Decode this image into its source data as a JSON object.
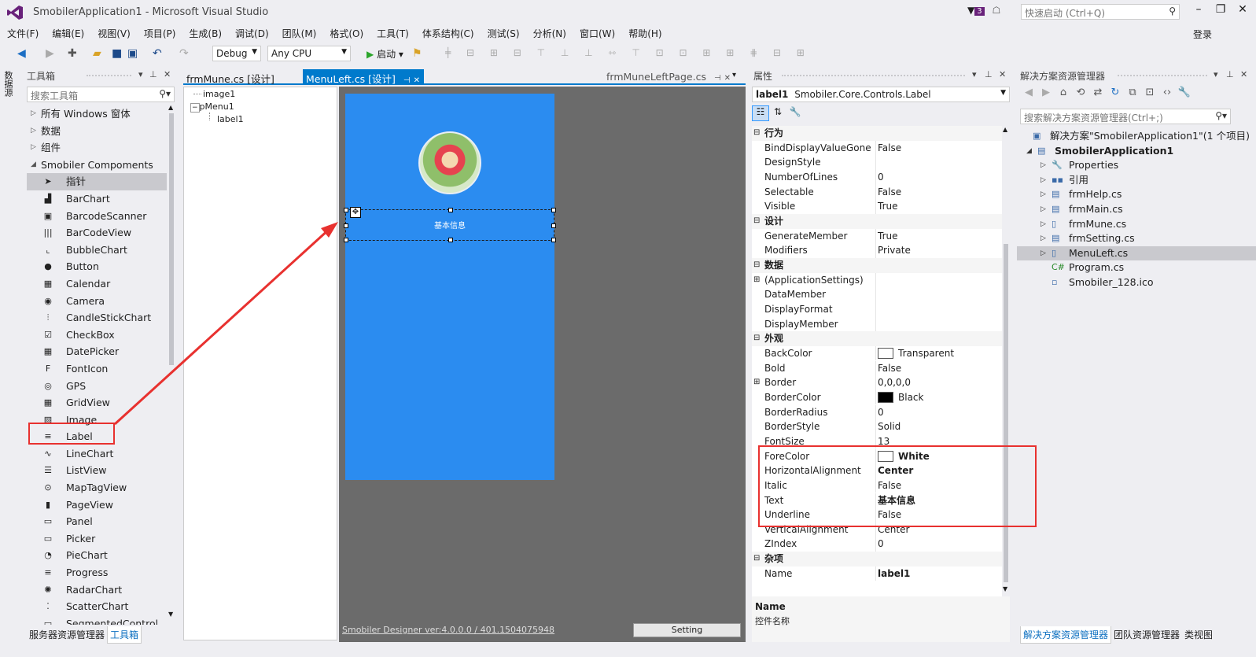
{
  "window": {
    "title": "SmobilerApplication1 - Microsoft Visual Studio",
    "notif_count": "3",
    "quick_launch_placeholder": "快速启动 (Ctrl+Q)",
    "login": "登录"
  },
  "menu": [
    "文件(F)",
    "编辑(E)",
    "视图(V)",
    "项目(P)",
    "生成(B)",
    "调试(D)",
    "团队(M)",
    "格式(O)",
    "工具(T)",
    "体系结构(C)",
    "测试(S)",
    "分析(N)",
    "窗口(W)",
    "帮助(H)"
  ],
  "toolbar": {
    "config": "Debug",
    "platform": "Any CPU",
    "start": "启动"
  },
  "left_strip": {
    "vertical_tab": "数据源"
  },
  "toolbox": {
    "title": "工具箱",
    "search_placeholder": "搜索工具箱",
    "categories": [
      "所有 Windows 窗体",
      "数据",
      "组件",
      "Smobiler Compoments"
    ],
    "items": [
      {
        "label": "指针",
        "icon": "pointer-icon",
        "selected": true
      },
      {
        "label": "BarChart",
        "icon": "bar-chart-icon"
      },
      {
        "label": "BarcodeScanner",
        "icon": "barcode-scanner-icon"
      },
      {
        "label": "BarCodeView",
        "icon": "barcode-icon"
      },
      {
        "label": "BubbleChart",
        "icon": "bubble-chart-icon"
      },
      {
        "label": "Button",
        "icon": "button-icon"
      },
      {
        "label": "Calendar",
        "icon": "calendar-icon"
      },
      {
        "label": "Camera",
        "icon": "camera-icon"
      },
      {
        "label": "CandleStickChart",
        "icon": "candlestick-icon"
      },
      {
        "label": "CheckBox",
        "icon": "checkbox-icon"
      },
      {
        "label": "DatePicker",
        "icon": "date-picker-icon"
      },
      {
        "label": "FontIcon",
        "icon": "font-icon-icon"
      },
      {
        "label": "GPS",
        "icon": "gps-icon"
      },
      {
        "label": "GridView",
        "icon": "grid-icon"
      },
      {
        "label": "Image",
        "icon": "image-icon"
      },
      {
        "label": "Label",
        "icon": "label-icon",
        "highlighted": true
      },
      {
        "label": "LineChart",
        "icon": "line-chart-icon"
      },
      {
        "label": "ListView",
        "icon": "list-icon"
      },
      {
        "label": "MapTagView",
        "icon": "map-pin-icon"
      },
      {
        "label": "PageView",
        "icon": "page-icon"
      },
      {
        "label": "Panel",
        "icon": "panel-icon"
      },
      {
        "label": "Picker",
        "icon": "picker-icon"
      },
      {
        "label": "PieChart",
        "icon": "pie-chart-icon"
      },
      {
        "label": "Progress",
        "icon": "progress-icon"
      },
      {
        "label": "RadarChart",
        "icon": "radar-chart-icon"
      },
      {
        "label": "ScatterChart",
        "icon": "scatter-chart-icon"
      },
      {
        "label": "SegmentedControl",
        "icon": "segmented-icon"
      }
    ],
    "bottom_tabs": [
      "服务器资源管理器",
      "工具箱"
    ]
  },
  "document": {
    "tabs": [
      {
        "label": "frmMune.cs [设计]"
      },
      {
        "label": "MenuLeft.cs [设计]",
        "active": true
      },
      {
        "label": "frmMuneLeftPage.cs"
      }
    ],
    "tree": [
      "image1",
      "pMenu1",
      "label1"
    ],
    "label_text": "基本信息",
    "version_link": "Smobiler Designer ver:4.0.0.0 / 401.1504075948",
    "setting_button": "Setting"
  },
  "properties": {
    "title": "属性",
    "object": "label1",
    "object_type": "Smobiler.Core.Controls.Label",
    "rows": [
      {
        "cat": "行为"
      },
      {
        "name": "BindDisplayValueGone",
        "value": "False"
      },
      {
        "name": "DesignStyle",
        "value": ""
      },
      {
        "name": "NumberOfLines",
        "value": "0"
      },
      {
        "name": "Selectable",
        "value": "False"
      },
      {
        "name": "Visible",
        "value": "True"
      },
      {
        "cat": "设计"
      },
      {
        "name": "GenerateMember",
        "value": "True"
      },
      {
        "name": "Modifiers",
        "value": "Private"
      },
      {
        "cat": "数据"
      },
      {
        "name": "(ApplicationSettings)",
        "value": "",
        "expand": true
      },
      {
        "name": "DataMember",
        "value": ""
      },
      {
        "name": "DisplayFormat",
        "value": ""
      },
      {
        "name": "DisplayMember",
        "value": ""
      },
      {
        "cat": "外观"
      },
      {
        "name": "BackColor",
        "value": "Transparent",
        "swatch": "#ffffff"
      },
      {
        "name": "Bold",
        "value": "False"
      },
      {
        "name": "Border",
        "value": "0,0,0,0",
        "expand": true
      },
      {
        "name": "BorderColor",
        "value": "Black",
        "swatch": "#000000"
      },
      {
        "name": "BorderRadius",
        "value": "0"
      },
      {
        "name": "BorderStyle",
        "value": "Solid"
      },
      {
        "name": "FontSize",
        "value": "13"
      },
      {
        "name": "ForeColor",
        "value": "White",
        "swatch": "#ffffff",
        "bold": true
      },
      {
        "name": "HorizontalAlignment",
        "value": "Center",
        "bold": true
      },
      {
        "name": "Italic",
        "value": "False"
      },
      {
        "name": "Text",
        "value": "基本信息",
        "bold": true
      },
      {
        "name": "Underline",
        "value": "False"
      },
      {
        "name": "VerticalAlignment",
        "value": "Center"
      },
      {
        "name": "ZIndex",
        "value": "0"
      },
      {
        "cat": "杂项"
      },
      {
        "name": "Name",
        "value": "label1",
        "bold": true
      }
    ],
    "desc_name": "Name",
    "desc_text": "控件名称"
  },
  "solution": {
    "title": "解决方案资源管理器",
    "search_placeholder": "搜索解决方案资源管理器(Ctrl+;)",
    "items": [
      {
        "label": "解决方案\"SmobilerApplication1\"(1 个项目)",
        "level": 0,
        "icon": "solution-icon"
      },
      {
        "label": "SmobilerApplication1",
        "level": 1,
        "icon": "csharp-project-icon",
        "bold": true,
        "expanded": true
      },
      {
        "label": "Properties",
        "level": 2,
        "icon": "wrench-icon"
      },
      {
        "label": "引用",
        "level": 2,
        "icon": "references-icon"
      },
      {
        "label": "frmHelp.cs",
        "level": 2,
        "icon": "form-icon"
      },
      {
        "label": "frmMain.cs",
        "level": 2,
        "icon": "form-icon"
      },
      {
        "label": "frmMune.cs",
        "level": 2,
        "icon": "doc-icon"
      },
      {
        "label": "frmSetting.cs",
        "level": 2,
        "icon": "form-icon"
      },
      {
        "label": "MenuLeft.cs",
        "level": 2,
        "icon": "doc-icon",
        "selected": true
      },
      {
        "label": "Program.cs",
        "level": 2,
        "icon": "csharp-file-icon"
      },
      {
        "label": "Smobiler_128.ico",
        "level": 2,
        "icon": "ico-file-icon"
      }
    ],
    "bottom_tabs": [
      "解决方案资源管理器",
      "团队资源管理器",
      "类视图"
    ]
  },
  "colors": {
    "accent": "#007acc",
    "phone_bg": "#2b8cf0",
    "annotation": "#e8312f"
  }
}
